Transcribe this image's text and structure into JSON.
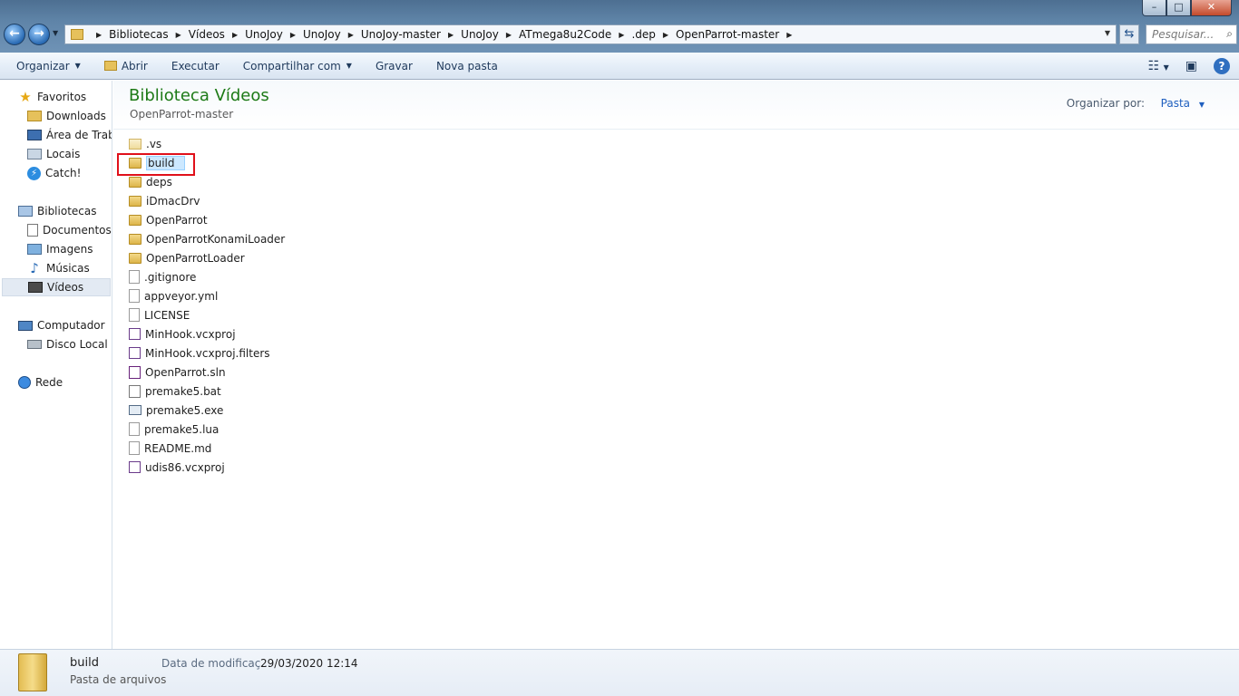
{
  "window": {
    "minimize": "–",
    "maximize": "□",
    "close": "✕"
  },
  "nav": {
    "back": "←",
    "forward": "→"
  },
  "breadcrumbs": [
    "Bibliotecas",
    "Vídeos",
    "UnoJoy",
    "UnoJoy",
    "UnoJoy-master",
    "UnoJoy",
    "ATmega8u2Code",
    ".dep",
    "OpenParrot-master"
  ],
  "search": {
    "placeholder": "Pesquisar..."
  },
  "toolbar": {
    "organize": "Organizar",
    "open": "Abrir",
    "execute": "Executar",
    "share": "Compartilhar com",
    "burn": "Gravar",
    "new_folder": "Nova pasta"
  },
  "sidebar": {
    "favorites": "Favoritos",
    "downloads": "Downloads",
    "desktop": "Área de Traba",
    "places": "Locais",
    "catch": "Catch!",
    "libraries": "Bibliotecas",
    "documents": "Documentos",
    "images": "Imagens",
    "music": "Músicas",
    "videos": "Vídeos",
    "computer": "Computador",
    "local_disk": "Disco Local (C",
    "network": "Rede"
  },
  "header": {
    "title": "Biblioteca Vídeos",
    "subtitle": "OpenParrot-master",
    "arrange_label": "Organizar por:",
    "arrange_value": "Pasta"
  },
  "files": [
    {
      "name": ".vs",
      "icon": "folder-light-icon"
    },
    {
      "name": "build",
      "icon": "folder-icon",
      "selected": true
    },
    {
      "name": "deps",
      "icon": "folder-icon"
    },
    {
      "name": "iDmacDrv",
      "icon": "folder-icon"
    },
    {
      "name": "OpenParrot",
      "icon": "folder-icon"
    },
    {
      "name": "OpenParrotKonamiLoader",
      "icon": "folder-icon"
    },
    {
      "name": "OpenParrotLoader",
      "icon": "folder-icon"
    },
    {
      "name": ".gitignore",
      "icon": "document-icon"
    },
    {
      "name": "appveyor.yml",
      "icon": "document-icon"
    },
    {
      "name": "LICENSE",
      "icon": "document-icon"
    },
    {
      "name": "MinHook.vcxproj",
      "icon": "vcxproj-icon"
    },
    {
      "name": "MinHook.vcxproj.filters",
      "icon": "filters-icon"
    },
    {
      "name": "OpenParrot.sln",
      "icon": "sln-icon"
    },
    {
      "name": "premake5.bat",
      "icon": "bat-icon"
    },
    {
      "name": "premake5.exe",
      "icon": "exe-icon"
    },
    {
      "name": "premake5.lua",
      "icon": "document-icon"
    },
    {
      "name": "README.md",
      "icon": "document-icon"
    },
    {
      "name": "udis86.vcxproj",
      "icon": "vcxproj-icon"
    }
  ],
  "details": {
    "name": "build",
    "type": "Pasta de arquivos",
    "modified_label": "Data de modificaç...",
    "modified_value": "29/03/2020 12:14"
  },
  "colors": {
    "title_green": "#1d7a16",
    "selection_blue": "#cce8ff",
    "highlight_red": "#e0101a"
  }
}
